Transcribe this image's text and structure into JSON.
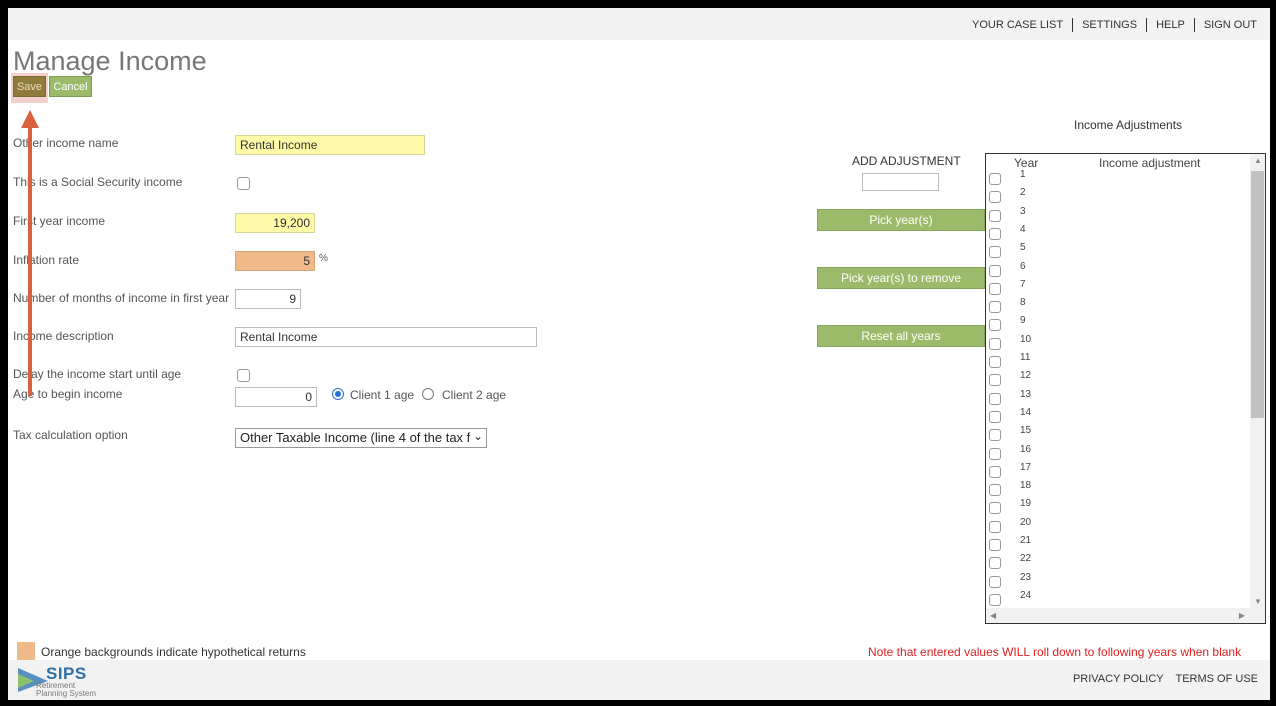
{
  "topnav": {
    "case_list": "YOUR CASE LIST",
    "settings": "SETTINGS",
    "help": "HELP",
    "sign_out": "SIGN OUT"
  },
  "page_title": "Manage Income",
  "toolbar": {
    "save_label": "Save",
    "cancel_label": "Cancel"
  },
  "form": {
    "other_income_name": {
      "label": "Other income name",
      "value": "Rental Income"
    },
    "social_security": {
      "label": "This is a Social Security income",
      "checked": false
    },
    "first_year_income": {
      "label": "First year income",
      "value": "19,200"
    },
    "inflation_rate": {
      "label": "Inflation rate",
      "value": "5",
      "unit": "%"
    },
    "months_first_year": {
      "label": "Number of months of income in first year",
      "value": "9"
    },
    "income_description": {
      "label": "Income description",
      "value": "Rental Income"
    },
    "delay_income": {
      "label": "Delay the income start until age",
      "checked": false
    },
    "age_to_begin": {
      "label": "Age to begin income",
      "value": "0",
      "options": [
        "Client 1 age",
        "Client 2 age"
      ],
      "selected": "Client 1 age"
    },
    "tax_option": {
      "label": "Tax calculation option",
      "value": "Other Taxable Income (line 4 of the tax for"
    }
  },
  "adjustments": {
    "add_label": "ADD ADJUSTMENT",
    "add_value": "",
    "pick_years": "Pick year(s)",
    "pick_years_remove": "Pick year(s) to remove",
    "reset_all": "Reset all years",
    "panel_title": "Income Adjustments",
    "col_year": "Year",
    "col_adjustment": "Income adjustment",
    "years": [
      "1",
      "2",
      "3",
      "4",
      "5",
      "6",
      "7",
      "8",
      "9",
      "10",
      "11",
      "12",
      "13",
      "14",
      "15",
      "16",
      "17",
      "18",
      "19",
      "20",
      "21",
      "22",
      "23",
      "24"
    ]
  },
  "legend_text": "Orange backgrounds indicate hypothetical returns",
  "note_text": "Note that entered values WILL roll down to following years when blank",
  "footer": {
    "logo_name": "SIPS",
    "logo_sub1": "Retirement",
    "logo_sub2": "Planning System",
    "privacy": "PRIVACY POLICY",
    "terms": "TERMS OF USE"
  },
  "colors": {
    "save_button": "#8f7c3d",
    "green_button": "#9cbb6a",
    "yellow_field": "#fdfaa8",
    "orange_field": "#f0b98a",
    "annotation_arrow": "#d9613f",
    "note_red": "#e02020"
  },
  "icons": [
    "chevron-down-icon",
    "radio-selected-icon",
    "radio-unselected-icon",
    "scroll-up-icon",
    "scroll-down-icon",
    "scroll-left-icon",
    "scroll-right-icon",
    "sips-logo-icon"
  ]
}
